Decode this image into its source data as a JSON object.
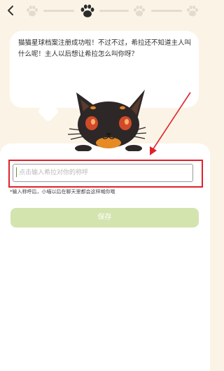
{
  "header": {
    "back_icon": "chevron-left-icon",
    "progress_steps": 4,
    "current_step": 2,
    "colors": {
      "inactive_paw": "#e3dbcc",
      "active_paw": "#2b2b2b"
    }
  },
  "speech_bubble": {
    "text": "猫猫星球档案注册成功啦！不过不过，希拉还不知道主人叫什么呢！主人以后想让希拉怎么叫你呀？"
  },
  "mascot": {
    "icon": "black-cat-mascot"
  },
  "name_input": {
    "value": "",
    "placeholder": "点击输入希拉对你的称呼"
  },
  "hint_text": "*输入称呼后，小喵以后在聊天里都会这样喊你哦",
  "save_button": {
    "label": "保存",
    "color": "#d3e4ae"
  },
  "annotation": {
    "highlight_color": "#e0212b"
  }
}
